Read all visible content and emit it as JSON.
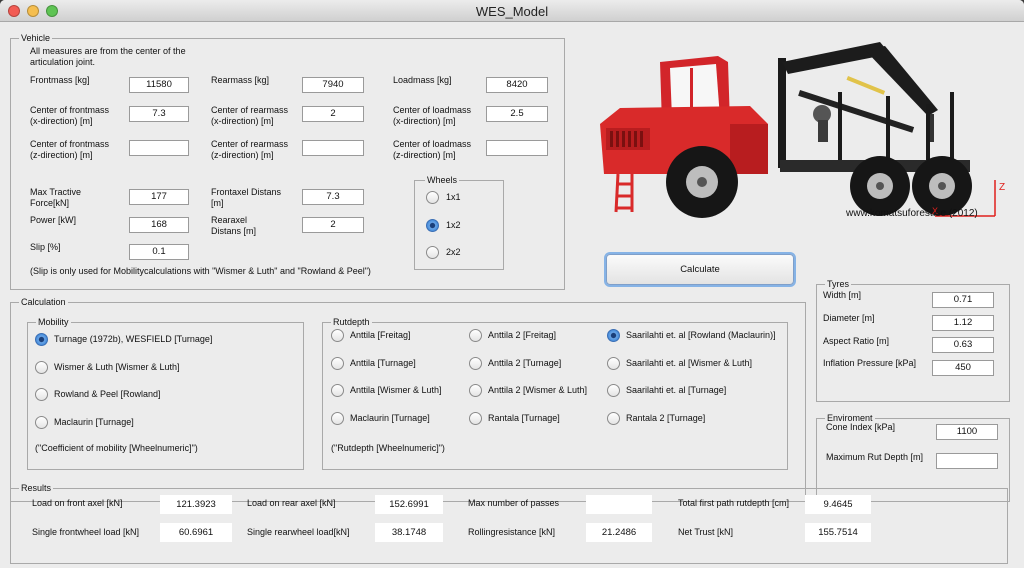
{
  "window": {
    "title": "WES_Model"
  },
  "vehicle": {
    "title": "Vehicle",
    "note": "All measures are from the center of the\narticulation joint.",
    "frontmass": {
      "label": "Frontmass [kg]",
      "value": "11580"
    },
    "rearmass": {
      "label": "Rearmass [kg]",
      "value": "7940"
    },
    "loadmass": {
      "label": "Loadmass [kg]",
      "value": "8420"
    },
    "center_front_x": {
      "label": "Center of frontmass\n(x-direction) [m]",
      "value": "7.3"
    },
    "center_rear_x": {
      "label": "Center of rearmass\n(x-direction) [m]",
      "value": "2"
    },
    "center_load_x": {
      "label": "Center of loadmass\n(x-direction) [m]",
      "value": "2.5"
    },
    "center_front_z": {
      "label": "Center of frontmass\n(z-direction) [m]",
      "value": ""
    },
    "center_rear_z": {
      "label": "Center of rearmass\n(z-direction) [m]",
      "value": ""
    },
    "center_load_z": {
      "label": "Center of loadmass\n(z-direction) [m]",
      "value": ""
    },
    "max_tractive": {
      "label": "Max Tractive\nForce[kN]",
      "value": "177"
    },
    "frontaxel": {
      "label": "Frontaxel Distans\n[m]",
      "value": "7.3"
    },
    "power": {
      "label": "Power [kW]",
      "value": "168"
    },
    "rearaxel": {
      "label": "Rearaxel\nDistans [m]",
      "value": "2"
    },
    "slip": {
      "label": "Slip [%]",
      "value": "0.1"
    },
    "slip_note": "(Slip is only used for Mobilitycalculations with \"Wismer & Luth\" and \"Rowland & Peel\")",
    "wheels": {
      "title": "Wheels",
      "options": [
        "1x1",
        "1x2",
        "2x2"
      ],
      "selected": "1x2"
    }
  },
  "image": {
    "credit": "www.komatsuforest.se (2012)",
    "z_axis": "Z",
    "x_axis": "X"
  },
  "calculate_button": "Calculate",
  "tyres": {
    "title": "Tyres",
    "width": {
      "label": "Width [m]",
      "value": "0.71"
    },
    "diameter": {
      "label": "Diameter [m]",
      "value": "1.12"
    },
    "aspect": {
      "label": "Aspect Ratio [m]",
      "value": "0.63"
    },
    "inflation": {
      "label": "Inflation Pressure [kPa]",
      "value": "450"
    }
  },
  "environment": {
    "title": "Enviroment",
    "cone": {
      "label": "Cone Index [kPa]",
      "value": "1100"
    },
    "max_rut": {
      "label": "Maximum Rut Depth [m]",
      "value": ""
    }
  },
  "calculation": {
    "title": "Calculation",
    "mobility": {
      "title": "Mobility",
      "options": [
        "Turnage (1972b), WESFIELD [Turnage]",
        "Wismer & Luth [Wismer & Luth]",
        "Rowland & Peel [Rowland]",
        "Maclaurin [Turnage]"
      ],
      "selected": "Turnage (1972b), WESFIELD [Turnage]",
      "note": "(\"Coefficient of mobility [Wheelnumeric]\")"
    },
    "rutdepth": {
      "title": "Rutdepth",
      "col1": [
        "Anttila [Freitag]",
        "Anttila [Turnage]",
        "Anttila [Wismer & Luth]",
        "Maclaurin [Turnage]"
      ],
      "col2": [
        "Anttila 2 [Freitag]",
        "Anttila 2 [Turnage]",
        "Anttila 2 [Wismer & Luth]",
        "Rantala [Turnage]"
      ],
      "col3": [
        "Saarilahti et. al [Rowland (Maclaurin)]",
        "Saarilahti et. al [Wismer & Luth]",
        "Saarilahti et. al [Turnage]",
        "Rantala 2 [Turnage]"
      ],
      "selected": "Saarilahti et. al [Rowland (Maclaurin)]",
      "note": "(\"Rutdepth [Wheelnumeric]\")"
    }
  },
  "results": {
    "title": "Results",
    "load_front": {
      "label": "Load on front axel [kN]",
      "value": "121.3923"
    },
    "load_rear": {
      "label": "Load on rear axel [kN]",
      "value": "152.6991"
    },
    "max_passes": {
      "label": "Max number of passes",
      "value": ""
    },
    "total_rut": {
      "label": "Total first path rutdepth [cm]",
      "value": "9.4645"
    },
    "single_front": {
      "label": "Single frontwheel load [kN]",
      "value": "60.6961"
    },
    "single_rear": {
      "label": "Single rearwheel load[kN]",
      "value": "38.1748"
    },
    "rolling": {
      "label": "Rollingresistance [kN]",
      "value": "21.2486"
    },
    "net_trust": {
      "label": "Net Trust [kN]",
      "value": "155.7514"
    }
  }
}
